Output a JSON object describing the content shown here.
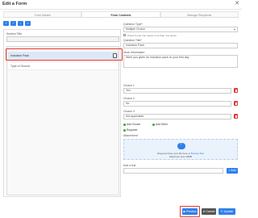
{
  "window": {
    "title": "Edit a Form",
    "close_glyph": "✕"
  },
  "tabs": [
    {
      "label": "Form Details"
    },
    {
      "label": "Form Contents"
    },
    {
      "label": "Manage Recipients"
    }
  ],
  "left": {
    "section_title_label": "Section Title",
    "rows": [
      "Induction Pack",
      "Type of Ground"
    ]
  },
  "right": {
    "question_type_label": "Question Type*",
    "question_type_value": "Multiple Choice",
    "checkbox_note": "Check if user can select more than one option",
    "question_title_label": "Question Title*",
    "question_title_value": "Induction Pack",
    "more_info_label": "More Information",
    "more_info_value": "Were you given an induction pack on your first day",
    "choices": [
      {
        "label": "Choice 1",
        "value": "Yes"
      },
      {
        "label": "Choice 2",
        "value": "No"
      },
      {
        "label": "Choice 3",
        "value": "Not applicable"
      }
    ],
    "add_choice_label": "Add Choice",
    "add_other_label": "Add Other",
    "required_label": "Required",
    "attachment_label": "Attachment",
    "dropzone_text": "Drag and drop your file here or",
    "dropzone_link": "Browse files",
    "dropzone_limit": "Maximum size 10MB",
    "add_link_label": "Add a link",
    "add_button": "+ Add"
  },
  "footer": {
    "preview": "▶ Preview",
    "cancel": "⊘ Cancel",
    "update": "✎ Update"
  },
  "colors": {
    "accent": "#2f80ed",
    "danger": "#e53935",
    "success": "#43a047"
  }
}
